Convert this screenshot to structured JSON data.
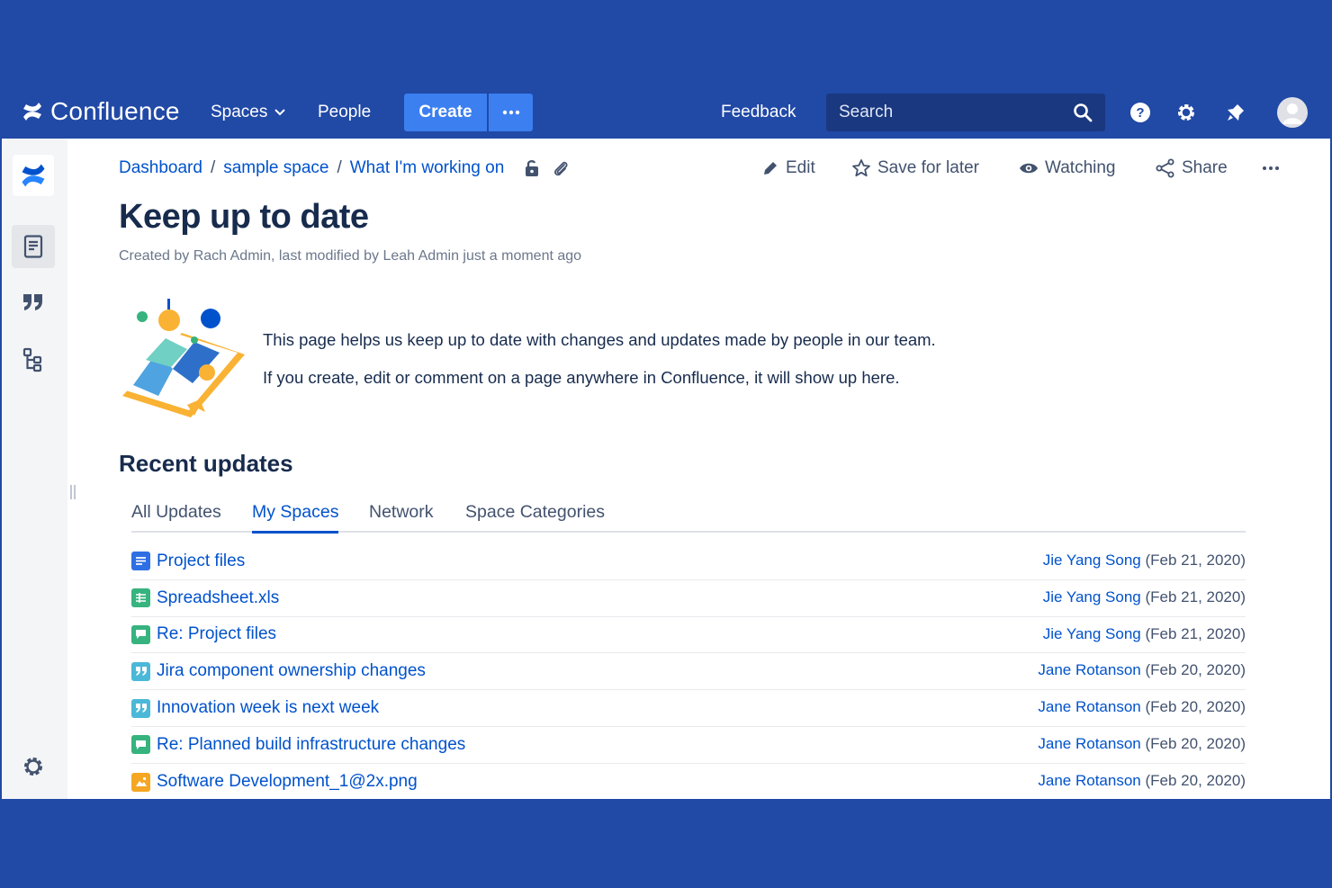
{
  "colors": {
    "brand": "#2149a6",
    "link": "#0052cc",
    "create": "#3c7ff0"
  },
  "topnav": {
    "logo_text": "Confluence",
    "spaces": "Spaces",
    "people": "People",
    "create": "Create",
    "more_icon": "ellipsis-icon",
    "feedback": "Feedback",
    "search_placeholder": "Search",
    "icons": [
      "help-icon",
      "settings-icon",
      "notifications-icon",
      "avatar"
    ]
  },
  "sidebar": {
    "items": [
      "pages-icon",
      "blog-quote-icon",
      "page-tree-icon",
      "settings-icon"
    ]
  },
  "breadcrumb": [
    "Dashboard",
    "sample space",
    "What I'm working on"
  ],
  "actions": {
    "edit": "Edit",
    "save": "Save for later",
    "watching": "Watching",
    "share": "Share"
  },
  "page": {
    "title": "Keep up to date",
    "byline": "Created by Rach Admin, last modified by Leah Admin just a moment ago",
    "intro1": "This page helps us keep up to date with changes and updates made by people in our team.",
    "intro2": "If you create, edit or comment on a page anywhere in Confluence, it will show up here."
  },
  "recent": {
    "heading": "Recent updates",
    "tabs": [
      "All Updates",
      "My Spaces",
      "Network",
      "Space Categories"
    ],
    "active_tab": "My Spaces",
    "items": [
      {
        "type": "page",
        "title": "Project files",
        "author": "Jie Yang Song",
        "date": "(Feb 21, 2020)"
      },
      {
        "type": "spreadsheet",
        "title": "Spreadsheet.xls",
        "author": "Jie Yang Song",
        "date": "(Feb 21, 2020)"
      },
      {
        "type": "comment",
        "title": "Re: Project files",
        "author": "Jie Yang Song",
        "date": "(Feb 21, 2020)"
      },
      {
        "type": "blog",
        "title": "Jira component ownership changes",
        "author": "Jane Rotanson",
        "date": "(Feb 20, 2020)"
      },
      {
        "type": "blog",
        "title": "Innovation week is next week",
        "author": "Jane Rotanson",
        "date": "(Feb 20, 2020)"
      },
      {
        "type": "comment",
        "title": "Re: Planned build infrastructure changes",
        "author": "Jane Rotanson",
        "date": "(Feb 20, 2020)"
      },
      {
        "type": "image",
        "title": "Software Development_1@2x.png",
        "author": "Jane Rotanson",
        "date": "(Feb 20, 2020)"
      }
    ]
  }
}
